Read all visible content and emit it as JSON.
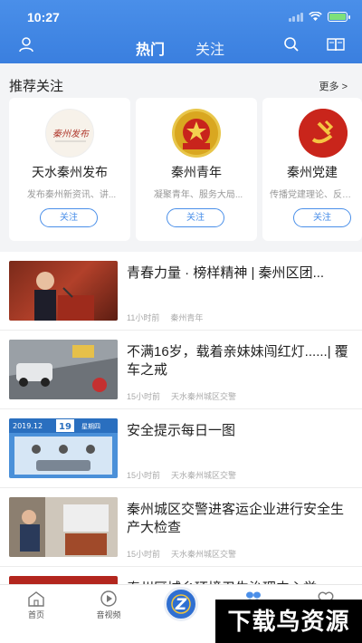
{
  "status": {
    "time": "10:27"
  },
  "header": {
    "tabs": [
      {
        "label": "热门",
        "active": true
      },
      {
        "label": "关注",
        "active": false
      }
    ],
    "icons": [
      "user-icon",
      "search-icon",
      "book-icon"
    ],
    "color": "#3a7fdf"
  },
  "recommend": {
    "title": "推荐关注",
    "more": "更多 >",
    "cards": [
      {
        "name": "天水秦州发布",
        "desc": "发布秦州新资讯、讲...",
        "button": "关注",
        "logo_text": "秦州发布"
      },
      {
        "name": "秦州青年",
        "desc": "凝聚青年、服务大局...",
        "button": "关注"
      },
      {
        "name": "秦州党建",
        "desc": "传播党建理论、反映...",
        "button": "关注"
      }
    ]
  },
  "articles": [
    {
      "title": "青春力量 · 榜样精神 | 秦州区团...",
      "time": "11小时前",
      "source": "秦州青年"
    },
    {
      "title": "不满16岁，载着亲妹妹闯红灯......| 覆车之戒",
      "time": "15小时前",
      "source": "天水秦州城区交警"
    },
    {
      "title": "安全提示每日一图",
      "time": "15小时前",
      "source": "天水秦州城区交警",
      "thumb_text": [
        "2019.12",
        "19",
        "星期四"
      ]
    },
    {
      "title": "秦州城区交警进客运企业进行安全生产大检查",
      "time": "15小时前",
      "source": "天水秦州城区交警"
    },
    {
      "title": "秦州区城乡环境卫生治理中心举",
      "time": "",
      "source": ""
    }
  ],
  "tabbar": {
    "items": [
      {
        "label": "首页",
        "icon": "home-icon"
      },
      {
        "label": "音视频",
        "icon": "play-icon"
      },
      {
        "label": "",
        "icon": "center-logo-icon"
      },
      {
        "label": "",
        "icon": "grid-icon"
      },
      {
        "label": "",
        "icon": "heart-icon"
      }
    ]
  },
  "watermark": "下载鸟资源"
}
